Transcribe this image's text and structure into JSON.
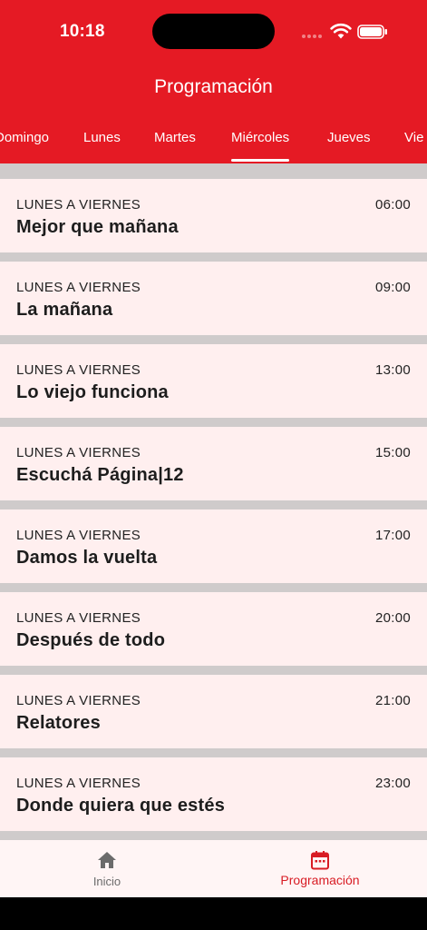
{
  "status_bar": {
    "time": "10:18"
  },
  "header": {
    "title": "Programación"
  },
  "tabs": [
    {
      "label": "Domingo"
    },
    {
      "label": "Lunes"
    },
    {
      "label": "Martes"
    },
    {
      "label": "Miércoles"
    },
    {
      "label": "Jueves"
    },
    {
      "label": "Vie"
    }
  ],
  "active_tab": "Miércoles",
  "programs": [
    {
      "days": "LUNES A VIERNES",
      "time": "06:00",
      "name": "Mejor que mañana"
    },
    {
      "days": "LUNES A VIERNES",
      "time": "09:00",
      "name": "La mañana"
    },
    {
      "days": "LUNES A VIERNES",
      "time": "13:00",
      "name": "Lo viejo funciona"
    },
    {
      "days": "LUNES A VIERNES",
      "time": "15:00",
      "name": "Escuchá Página|12"
    },
    {
      "days": "LUNES A VIERNES",
      "time": "17:00",
      "name": "Damos la vuelta"
    },
    {
      "days": "LUNES A VIERNES",
      "time": "20:00",
      "name": "Después de todo"
    },
    {
      "days": "LUNES A VIERNES",
      "time": "21:00",
      "name": "Relatores"
    },
    {
      "days": "LUNES A VIERNES",
      "time": "23:00",
      "name": "Donde quiera que estés"
    }
  ],
  "bottom_nav": {
    "home": {
      "label": "Inicio",
      "icon": "home-icon"
    },
    "schedule": {
      "label": "Programación",
      "icon": "calendar-icon"
    }
  },
  "colors": {
    "brand_red": "#E51A24",
    "card_bg": "#FFEFEF",
    "divider": "#CFCBCB",
    "active_nav": "#D81C24"
  }
}
